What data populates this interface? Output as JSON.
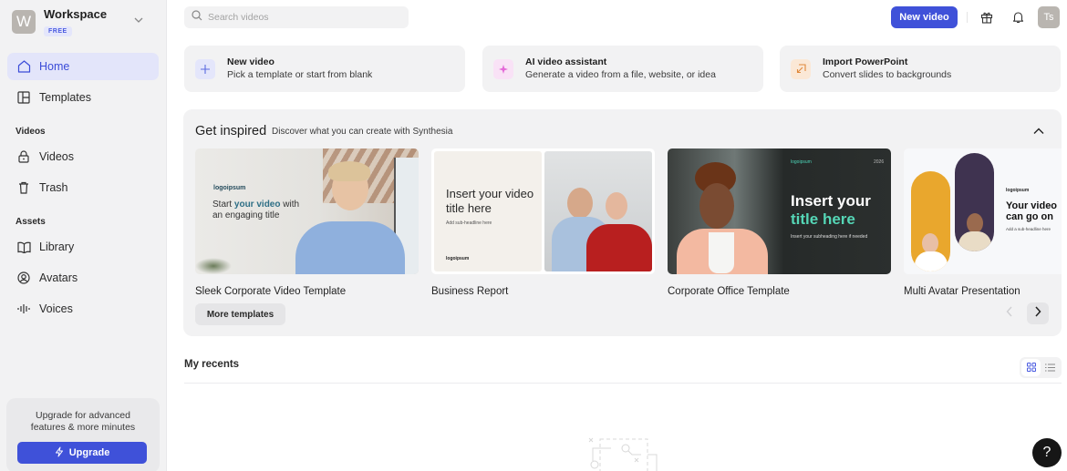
{
  "workspace": {
    "name": "Workspace",
    "initial": "W",
    "plan_badge": "FREE"
  },
  "sidebar": {
    "items": [
      {
        "label": "Home",
        "icon": "home-icon",
        "active": true
      },
      {
        "label": "Templates",
        "icon": "templates-icon"
      }
    ],
    "sections": [
      {
        "title": "Videos",
        "items": [
          {
            "label": "Videos",
            "icon": "lock-icon"
          },
          {
            "label": "Trash",
            "icon": "trash-icon"
          }
        ]
      },
      {
        "title": "Assets",
        "items": [
          {
            "label": "Library",
            "icon": "book-icon"
          },
          {
            "label": "Avatars",
            "icon": "avatar-icon"
          },
          {
            "label": "Voices",
            "icon": "waveform-icon"
          }
        ]
      }
    ],
    "upgrade": {
      "text_line1": "Upgrade for advanced",
      "text_line2": "features & more minutes",
      "button_label": "Upgrade"
    }
  },
  "topbar": {
    "search_placeholder": "Search videos",
    "search_value": "",
    "new_video_label": "New video",
    "user_initials": "Ts"
  },
  "quick_actions": [
    {
      "title": "New video",
      "subtitle": "Pick a template or start from blank",
      "icon": "plus-icon"
    },
    {
      "title": "AI video assistant",
      "subtitle": "Generate a video from a file, website, or idea",
      "icon": "sparkle-icon"
    },
    {
      "title": "Import PowerPoint",
      "subtitle": "Convert slides to backgrounds",
      "icon": "import-icon"
    }
  ],
  "inspired": {
    "title": "Get inspired",
    "subtitle": "Discover what you can create with Synthesia",
    "templates": [
      {
        "name": "Sleek Corporate Video Template",
        "thumb_brand": "logoipsum",
        "thumb_line1_a": "Start ",
        "thumb_line1_b": "your video",
        "thumb_line1_c": " with",
        "thumb_line2": "an engaging title"
      },
      {
        "name": "Business Report",
        "thumb_title": "Insert your video title here",
        "thumb_sub": "Add sub-headline here",
        "thumb_brand": "logoipsum"
      },
      {
        "name": "Corporate Office Template",
        "thumb_title_a": "Insert your",
        "thumb_title_b": "title here",
        "thumb_sub": "Insert your subheading here if needed",
        "thumb_brand": "logoipsum",
        "thumb_year": "2026"
      },
      {
        "name": "Multi Avatar Presentation",
        "thumb_title": "Your video can go on",
        "thumb_sub": "Add a sub-headline here",
        "thumb_brand": "logoipsum"
      }
    ],
    "more_label": "More templates"
  },
  "recents": {
    "title": "My recents",
    "view": "grid"
  },
  "help_label": "?",
  "colors": {
    "accent": "#3f51d9",
    "sidebar_bg": "#f2f2f3",
    "active_nav_bg": "#e3e5fa"
  }
}
